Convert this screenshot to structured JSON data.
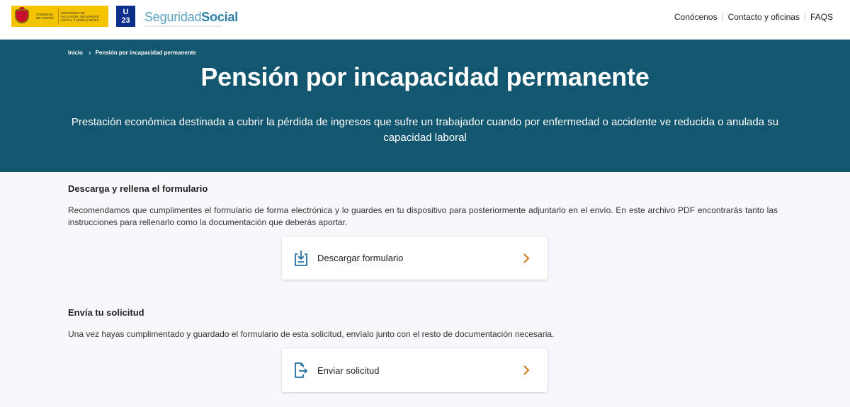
{
  "header": {
    "gov_logo_left_text": "GOBIERNO DE ESPAÑA",
    "gov_logo_right_text": "MINISTERIO DE INCLUSIÓN, SEGURIDAD SOCIAL Y MIGRACIONES",
    "u23_line1": "U",
    "u23_line2": "23",
    "brand_part1": "Seguridad",
    "brand_part2": "Social",
    "nav": [
      "Conócenos",
      "Contacto y oficinas",
      "FAQS"
    ]
  },
  "breadcrumb": {
    "home": "Inicio",
    "current": "Pensión por incapacidad permanente"
  },
  "hero": {
    "title": "Pensión por incapacidad permanente",
    "subtitle": "Prestación económica destinada a cubrir la pérdida de ingresos que sufre un trabajador cuando por enfermedad o accidente ve reducida o anulada su capacidad laboral"
  },
  "sections": [
    {
      "title": "Descarga y rellena el formulario",
      "text": "Recomendamos que cumplimentes el formulario de forma electrónica y lo guardes en tu dispositivo para posteriormente adjuntarlo en el envío. En este archivo PDF encontrarás tanto las instrucciones para rellenarlo como la documentación que deberás aportar.",
      "card_label": "Descargar formulario",
      "card_icon": "download-icon"
    },
    {
      "title": "Envía tu solicitud",
      "text": "Una vez hayas cumplimentado y guardado el formulario de esta solicitud, envíalo junto con el resto de documentación necesaria.",
      "card_label": "Enviar solicitud",
      "card_icon": "send-file-icon"
    }
  ],
  "colors": {
    "hero_bg": "#13566f",
    "page_bg": "#f7f8fb",
    "icon_blue": "#1f6fa3",
    "arrow_orange": "#c77a1a"
  }
}
